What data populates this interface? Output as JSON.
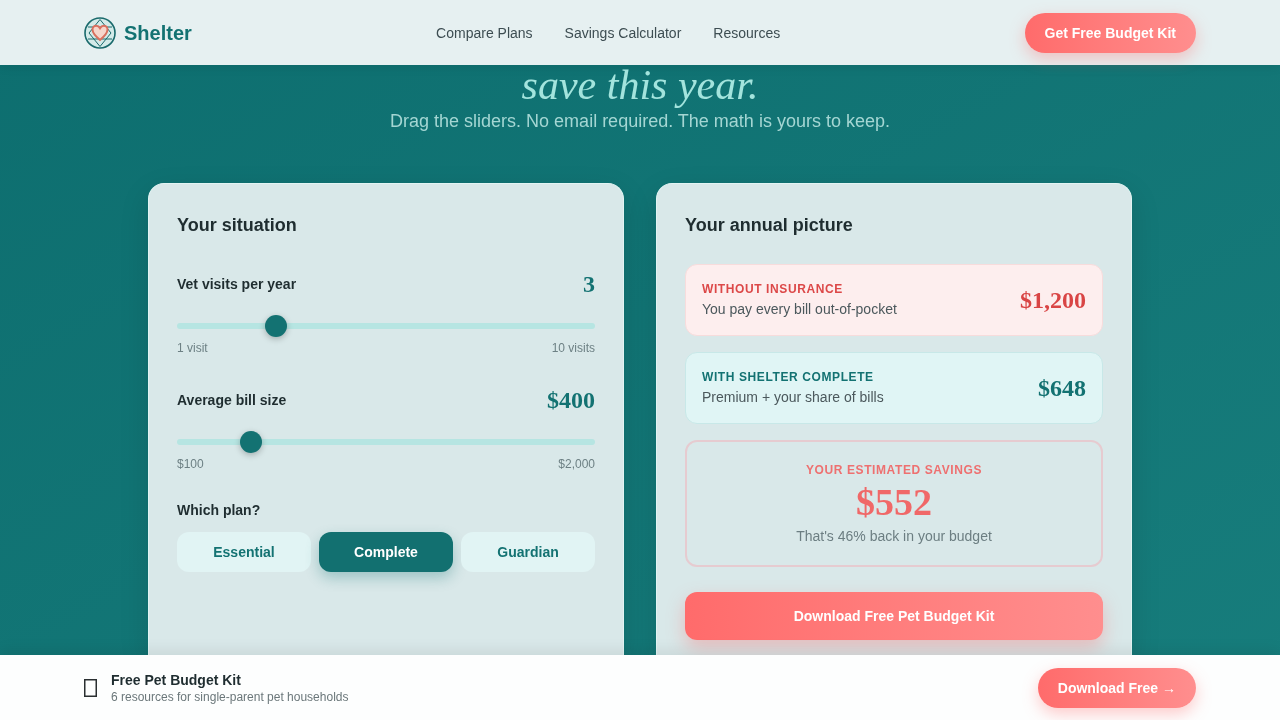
{
  "header": {
    "brand": "Shelter",
    "nav": [
      "Compare Plans",
      "Savings Calculator",
      "Resources"
    ],
    "cta": "Get Free Budget Kit"
  },
  "hero": {
    "heading": "save this year.",
    "subtitle": "Drag the sliders. No email required. The math is yours to keep."
  },
  "situation": {
    "title": "Your situation",
    "sliders": [
      {
        "label": "Vet visits per year",
        "value": "3",
        "level": 0.222,
        "min_label": "1 visit",
        "max_label": "10 visits"
      },
      {
        "label": "Average bill size",
        "value": "$400",
        "level": 0.158,
        "min_label": "$100",
        "max_label": "$2,000"
      }
    ],
    "plan_label": "Which plan?",
    "plans": [
      {
        "label": "Essential",
        "selected": false
      },
      {
        "label": "Complete",
        "selected": true
      },
      {
        "label": "Guardian",
        "selected": false
      }
    ]
  },
  "annual_picture": {
    "title": "Your annual picture",
    "costs": [
      {
        "kind": "uninsured",
        "label": "WITHOUT INSURANCE",
        "description": "You pay every bill out-of-pocket",
        "amount": "$1,200"
      },
      {
        "kind": "insured",
        "label": "WITH SHELTER COMPLETE",
        "description": "Premium + your share of bills",
        "amount": "$648"
      }
    ],
    "savings": {
      "label": "YOUR ESTIMATED SAVINGS",
      "amount": "$552",
      "note": "That's 46% back in your budget"
    },
    "download_button": "Download Free Pet Budget Kit"
  },
  "bottom_bar": {
    "title": "Free Pet Budget Kit",
    "subtitle": "6 resources for single-parent pet households",
    "button": "Download Free →"
  }
}
